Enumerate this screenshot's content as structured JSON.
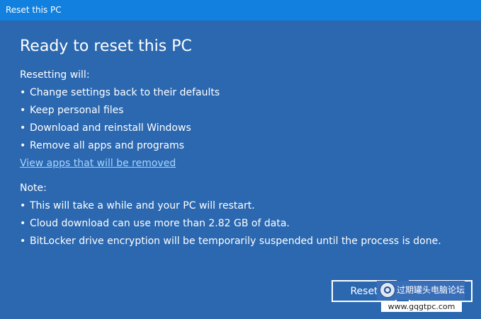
{
  "window": {
    "title": "Reset this PC"
  },
  "main": {
    "heading": "Ready to reset this PC",
    "resetting_label": "Resetting will:",
    "resetting_items": [
      "Change settings back to their defaults",
      "Keep personal files",
      "Download and reinstall Windows",
      "Remove all apps and programs"
    ],
    "apps_link": "View apps that will be removed",
    "note_label": "Note:",
    "note_items": [
      "This will take a while and your PC will restart.",
      "Cloud download can use more than 2.82 GB of data.",
      "BitLocker drive encryption will be temporarily suspended until the process is done."
    ],
    "bullet": "•"
  },
  "buttons": {
    "reset": "Reset",
    "cancel": ""
  },
  "watermark": {
    "text": "过期罐头电脑论坛",
    "url": "www.gqgtpc.com"
  },
  "colors": {
    "background": "#2b68b0",
    "titlebar": "#1180de",
    "link": "#a9d4ff",
    "text": "#ffffff"
  }
}
